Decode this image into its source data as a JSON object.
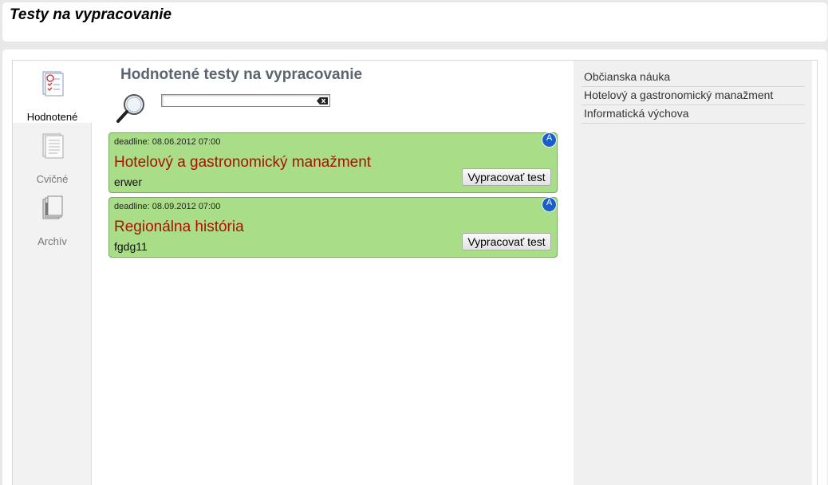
{
  "header": {
    "title": "Testy na vypracovanie"
  },
  "leftnav": {
    "items": [
      {
        "label": "Hodnotené",
        "icon": "graded-tests-icon",
        "active": true
      },
      {
        "label": "Cvičné",
        "icon": "practice-tests-icon",
        "active": false
      },
      {
        "label": "Archív",
        "icon": "archive-icon",
        "active": false
      }
    ]
  },
  "main": {
    "title": "Hodnotené testy na vypracovanie",
    "search": {
      "value": "",
      "placeholder": ""
    },
    "tests": [
      {
        "deadline": "deadline: 08.06.2012 07:00",
        "title": "Hotelový a gastronomický manažment",
        "desc": "erwer",
        "badge": "A",
        "button": "Vypracovať test"
      },
      {
        "deadline": "deadline: 08.09.2012 07:00",
        "title": "Regionálna história",
        "desc": "fgdg11",
        "badge": "A",
        "button": "Vypracovať test"
      }
    ]
  },
  "subjects": [
    "Občianska náuka",
    "Hotelový a gastronomický manažment",
    "Informatická výchova"
  ],
  "colors": {
    "card_bg": "#aadd88",
    "card_title": "#aa1100",
    "badge": "#1a5fc8",
    "title": "#5a6570"
  }
}
